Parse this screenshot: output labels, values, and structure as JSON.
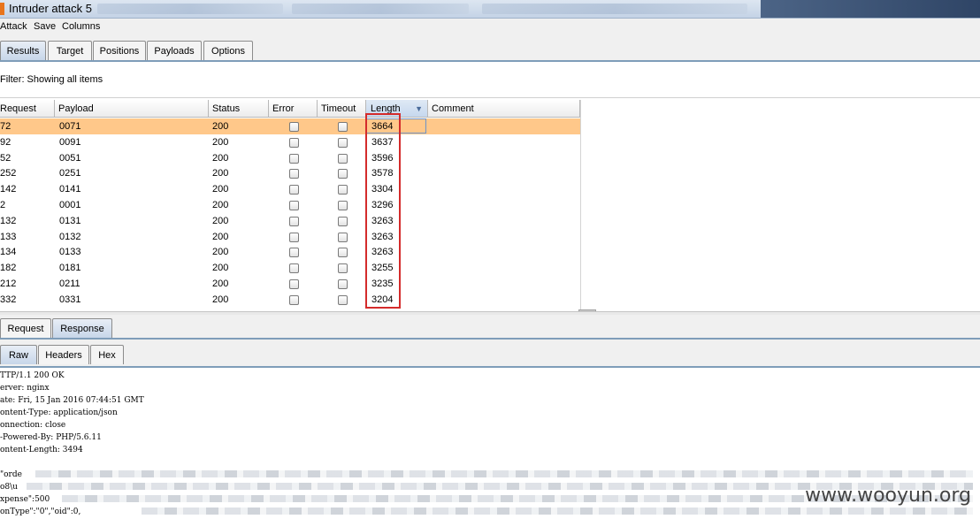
{
  "window": {
    "title": "Intruder attack 5"
  },
  "menu": [
    "Attack",
    "Save",
    "Columns"
  ],
  "main_tabs": [
    "Results",
    "Target",
    "Positions",
    "Payloads",
    "Options"
  ],
  "filter": "Filter: Showing all items",
  "table": {
    "columns": [
      "Request",
      "Payload",
      "Status",
      "Error",
      "Timeout",
      "Length",
      "Comment"
    ],
    "rows": [
      {
        "request": "72",
        "payload": "0071",
        "status": "200",
        "length": "3664"
      },
      {
        "request": "92",
        "payload": "0091",
        "status": "200",
        "length": "3637"
      },
      {
        "request": "52",
        "payload": "0051",
        "status": "200",
        "length": "3596"
      },
      {
        "request": "252",
        "payload": "0251",
        "status": "200",
        "length": "3578"
      },
      {
        "request": "142",
        "payload": "0141",
        "status": "200",
        "length": "3304"
      },
      {
        "request": "2",
        "payload": "0001",
        "status": "200",
        "length": "3296"
      },
      {
        "request": "132",
        "payload": "0131",
        "status": "200",
        "length": "3263"
      },
      {
        "request": "133",
        "payload": "0132",
        "status": "200",
        "length": "3263"
      },
      {
        "request": "134",
        "payload": "0133",
        "status": "200",
        "length": "3263"
      },
      {
        "request": "182",
        "payload": "0181",
        "status": "200",
        "length": "3255"
      },
      {
        "request": "212",
        "payload": "0211",
        "status": "200",
        "length": "3235"
      },
      {
        "request": "332",
        "payload": "0331",
        "status": "200",
        "length": "3204"
      }
    ]
  },
  "detail_tabs": [
    "Request",
    "Response"
  ],
  "view_tabs": [
    "Raw",
    "Headers",
    "Hex"
  ],
  "response_lines": [
    "TTP/1.1 200 OK",
    "erver: nginx",
    "ate: Fri, 15 Jan 2016 07:44:51 GMT",
    "ontent-Type: application/json",
    "onnection: close",
    "-Powered-By: PHP/5.6.11",
    "ontent-Length: 3494",
    "",
    "\"orde",
    "o8\\u",
    "xpense\":500",
    "onType\":\"0\",\"oid\":0,"
  ],
  "watermark": "www.wooyun.org",
  "colors": {
    "selected_row": "#ffc88a",
    "highlight_box": "#d42b2b"
  }
}
